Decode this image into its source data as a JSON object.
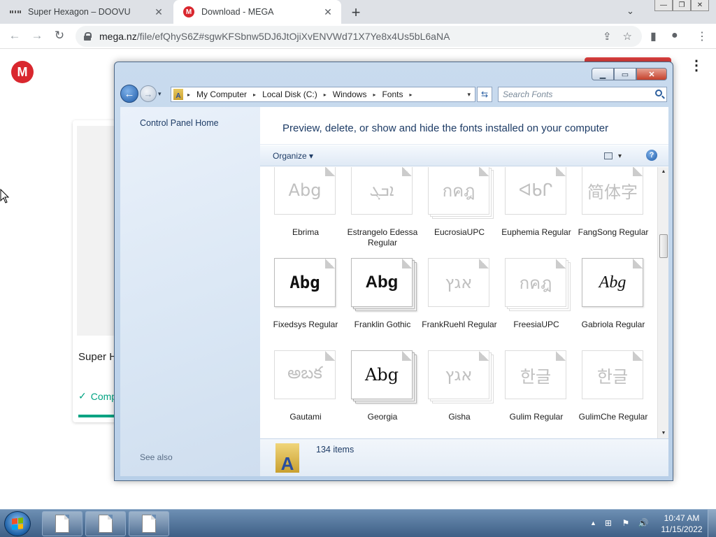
{
  "browser": {
    "tabs": [
      {
        "title": "Super Hexagon – DOOVU",
        "active": false,
        "favicon": "doovu-dots-icon"
      },
      {
        "title": "Download - MEGA",
        "active": true,
        "favicon": "mega-logo-icon"
      }
    ],
    "close_glyph": "✕",
    "new_tab_glyph": "+",
    "tab_search_glyph": "⌄",
    "window_controls": {
      "minimize": "—",
      "restore": "❐",
      "close": "✕"
    },
    "nav": {
      "back": "←",
      "forward": "→",
      "reload": "↻"
    },
    "url_host": "mega.nz",
    "url_path": "/file/efQhyS6Z#sgwKFSbnw5DJ6JtOjiXvENVWd71X7Ye8x4Us5bL6aNA",
    "omnibox_icons": {
      "share": "⇪",
      "bookmark": "☆"
    },
    "right_icons": {
      "sidepanel": "▮",
      "profile": "●",
      "menu": "⋮"
    }
  },
  "mega": {
    "logo": "M",
    "menu": "⋮",
    "file_name": "Super Hexagon",
    "status": "Completed",
    "check": "✓",
    "accent_color": "#d9272e",
    "success_color": "#00a382"
  },
  "explorer": {
    "caption_buttons": {
      "minimize": "▁",
      "maximize": "▭",
      "close": "✕"
    },
    "nav": {
      "back": "←",
      "forward": "→",
      "history": "▾"
    },
    "breadcrumb": [
      "My Computer",
      "Local Disk (C:)",
      "Windows",
      "Fonts"
    ],
    "breadcrumb_sep": "▸",
    "address_dropdown": "▾",
    "address_icon_letter": "A",
    "refresh": "⇆",
    "search_placeholder": "Search Fonts",
    "left_pane": {
      "home_link": "Control Panel Home",
      "see_also": "See also"
    },
    "header": "Preview, delete, or show and hide the fonts installed on your computer",
    "command_bar": {
      "organize": "Organize ▾",
      "view_arrow": "▾",
      "help": "?"
    },
    "scroll": {
      "up": "▲",
      "down": "▼"
    },
    "fonts": [
      {
        "name": "Ebrima",
        "sample": "Abg",
        "faded": true,
        "stacked": false
      },
      {
        "name": "Estrangelo Edessa Regular",
        "sample": "ܐܒܓ",
        "faded": true,
        "stacked": false
      },
      {
        "name": "EucrosiaUPC",
        "sample": "กคฎ",
        "faded": true,
        "stacked": true
      },
      {
        "name": "Euphemia Regular",
        "sample": "ᐊᑲᒋ",
        "faded": true,
        "stacked": false
      },
      {
        "name": "FangSong Regular",
        "sample": "简体字",
        "faded": true,
        "stacked": false
      },
      {
        "name": "Fixedsys Regular",
        "sample": "Abg",
        "faded": false,
        "stacked": false
      },
      {
        "name": "Franklin Gothic",
        "sample": "Abg",
        "faded": false,
        "stacked": true
      },
      {
        "name": "FrankRuehl Regular",
        "sample": "אגץ",
        "faded": true,
        "stacked": false
      },
      {
        "name": "FreesiaUPC",
        "sample": "กคฎ",
        "faded": true,
        "stacked": true
      },
      {
        "name": "Gabriola Regular",
        "sample": "Abg",
        "faded": false,
        "stacked": false
      },
      {
        "name": "Gautami",
        "sample": "అబక",
        "faded": true,
        "stacked": false
      },
      {
        "name": "Georgia",
        "sample": "Abg",
        "faded": false,
        "stacked": true
      },
      {
        "name": "Gisha",
        "sample": "אגץ",
        "faded": true,
        "stacked": true
      },
      {
        "name": "Gulim Regular",
        "sample": "한글",
        "faded": true,
        "stacked": false
      },
      {
        "name": "GulimChe Regular",
        "sample": "한글",
        "faded": true,
        "stacked": false
      }
    ],
    "item_count": "134 items"
  },
  "taskbar": {
    "tasks": 3,
    "tray_arrow": "▲",
    "tray_icons": [
      "network-icon",
      "action-center-icon",
      "volume-icon"
    ],
    "tray_glyphs": [
      "⊞",
      "⚑",
      "🔊"
    ],
    "time": "10:47 AM",
    "date": "11/15/2022"
  }
}
